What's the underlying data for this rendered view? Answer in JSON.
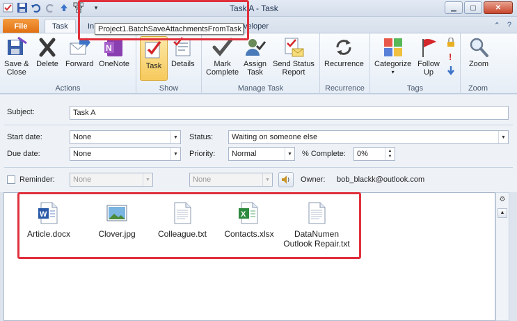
{
  "window": {
    "title": "Task A - Task",
    "buttons": [
      "minimize",
      "maximize",
      "close"
    ]
  },
  "qat": {
    "icons": [
      "app-icon",
      "save-icon",
      "undo-icon",
      "redo-icon",
      "up-icon",
      "macro-icon",
      "qat-more-icon"
    ]
  },
  "tabs": {
    "file": "File",
    "task": "Task",
    "insert_partial": "In",
    "developer_partial": "veloper"
  },
  "tooltip": {
    "text": "Project1.BatchSaveAttachmentsFromTask"
  },
  "ribbon": {
    "actions": {
      "label": "Actions",
      "save_close": "Save &\nClose",
      "delete": "Delete",
      "forward": "Forward",
      "onenote": "OneNote"
    },
    "show": {
      "label": "Show",
      "task": "Task",
      "details": "Details"
    },
    "manage_task": {
      "label": "Manage Task",
      "mark_complete": "Mark\nComplete",
      "assign_task": "Assign\nTask",
      "send_status": "Send Status\nReport"
    },
    "recurrence": {
      "label": "Recurrence",
      "recurrence": "Recurrence"
    },
    "tags": {
      "label": "Tags",
      "categorize": "Categorize",
      "follow_up": "Follow\nUp"
    },
    "zoom": {
      "label": "Zoom",
      "zoom": "Zoom"
    }
  },
  "form": {
    "subject_label": "Subject:",
    "subject_value": "Task A",
    "start_date_label": "Start date:",
    "start_date_value": "None",
    "due_date_label": "Due date:",
    "due_date_value": "None",
    "status_label": "Status:",
    "status_value": "Waiting on someone else",
    "priority_label": "Priority:",
    "priority_value": "Normal",
    "complete_label": "% Complete:",
    "complete_value": "0%",
    "reminder_label": "Reminder:",
    "reminder_date": "None",
    "reminder_time": "None",
    "owner_label": "Owner:",
    "owner_value": "bob_blackk@outlook.com"
  },
  "attachments": [
    {
      "name": "Article.docx",
      "icon": "word-icon"
    },
    {
      "name": "Clover.jpg",
      "icon": "image-icon"
    },
    {
      "name": "Colleague.txt",
      "icon": "text-file-icon"
    },
    {
      "name": "Contacts.xlsx",
      "icon": "excel-icon"
    },
    {
      "name": "DataNumen\nOutlook Repair.txt",
      "icon": "text-file-icon"
    }
  ],
  "colors": {
    "highlight": "#e0303c",
    "file_tab": "#e6751a"
  }
}
